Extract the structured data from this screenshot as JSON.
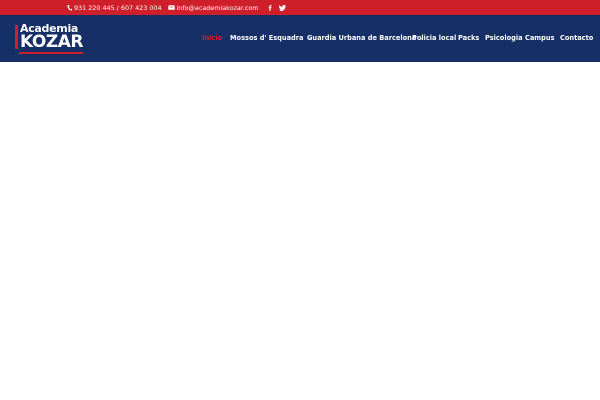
{
  "topbar": {
    "phone": "931 220 445 / 607 423 004",
    "email": "info@academiakozar.com",
    "social": [
      "facebook-icon",
      "twitter-icon"
    ],
    "bg_color": "#cf1f2a"
  },
  "header": {
    "bg_color": "#162f66",
    "logo": {
      "line1": "Academia",
      "line2": "KOZAR"
    }
  },
  "nav": {
    "items": [
      {
        "label": "Inicio",
        "active": true,
        "has_dropdown": false
      },
      {
        "label": "Mossos d' Esquadra",
        "active": false,
        "has_dropdown": true
      },
      {
        "label": "Guardia Urbana de Barcelona",
        "active": false,
        "has_dropdown": true
      },
      {
        "label": "Policia local",
        "active": false,
        "has_dropdown": false
      },
      {
        "label": "Packs",
        "active": false,
        "has_dropdown": false
      },
      {
        "label": "Psicologia",
        "active": false,
        "has_dropdown": false
      },
      {
        "label": "Campus",
        "active": false,
        "has_dropdown": false
      },
      {
        "label": "Contacto",
        "active": false,
        "has_dropdown": false
      }
    ],
    "dropdown_glyph": "⌄"
  }
}
